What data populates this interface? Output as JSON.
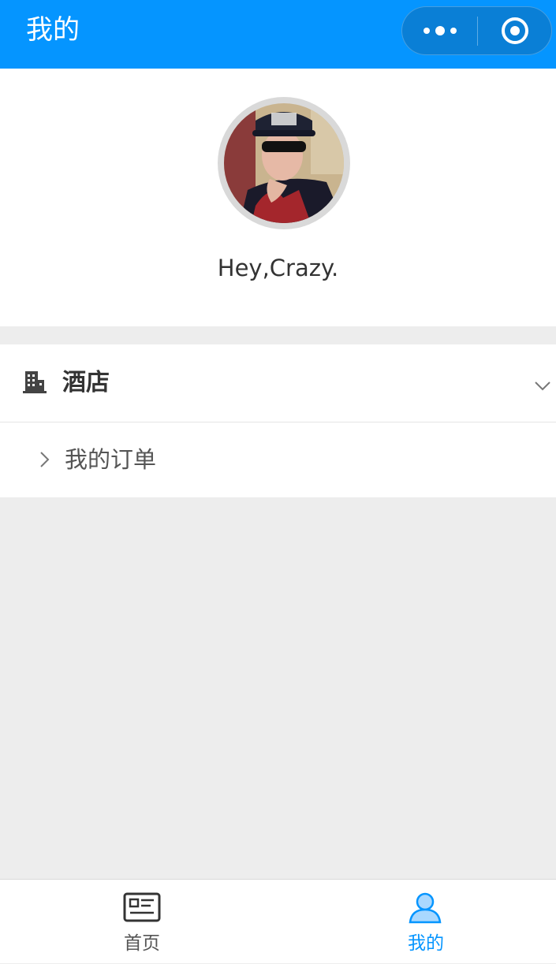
{
  "nav": {
    "title": "我的",
    "more_icon": "more-dots-icon",
    "close_icon": "target-close-icon",
    "background": "#0595ff"
  },
  "profile": {
    "greeting": "Hey,Crazy."
  },
  "hotel_section": {
    "label": "酒店",
    "icon": "building-icon",
    "expand_icon": "chevron-down-icon"
  },
  "order_item": {
    "label": "我的订单",
    "icon": "chevron-right-icon"
  },
  "tabbar": {
    "home_label": "首页",
    "home_icon": "news-card-icon",
    "mine_label": "我的",
    "mine_icon": "user-icon",
    "active_color": "#0595ff"
  }
}
